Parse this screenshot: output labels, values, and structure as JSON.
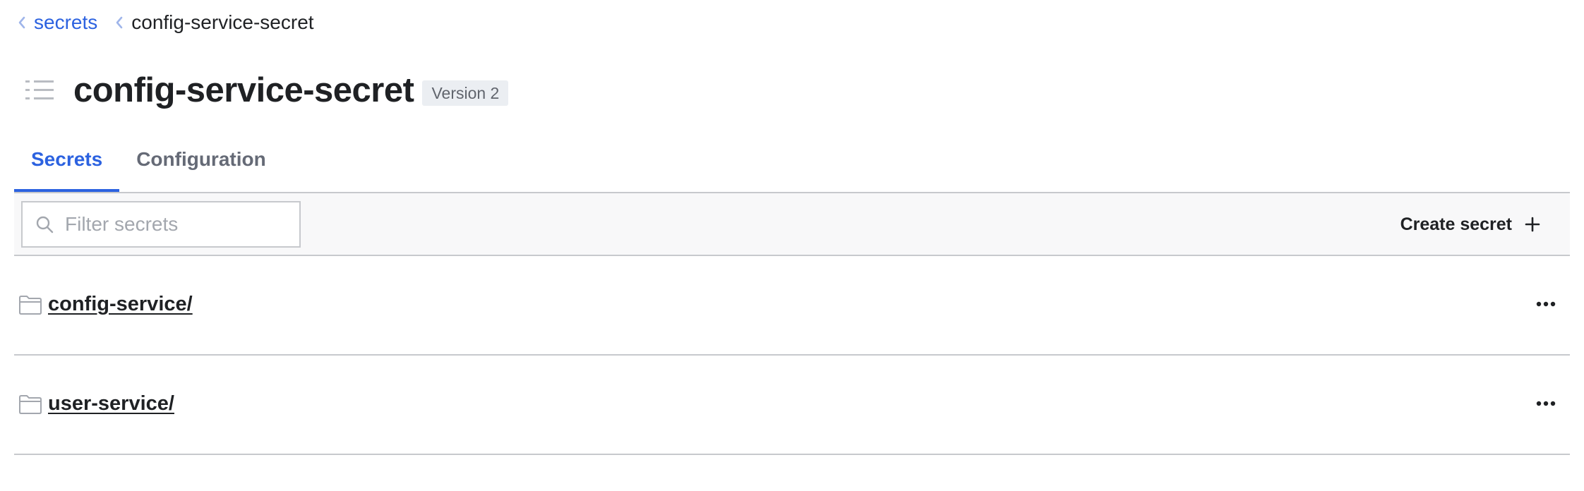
{
  "breadcrumb": {
    "items": [
      {
        "label": "secrets"
      },
      {
        "label": "config-service-secret"
      }
    ]
  },
  "header": {
    "title": "config-service-secret",
    "version_badge": "Version 2"
  },
  "tabs": [
    {
      "label": "Secrets",
      "active": true
    },
    {
      "label": "Configuration",
      "active": false
    }
  ],
  "toolbar": {
    "filter_placeholder": "Filter secrets",
    "filter_value": "",
    "create_label": "Create secret"
  },
  "list": {
    "items": [
      {
        "label": "config-service/",
        "icon": "folder-icon"
      },
      {
        "label": "user-service/",
        "icon": "folder-icon"
      }
    ]
  },
  "colors": {
    "accent": "#2c62e0",
    "text": "#1f2124",
    "muted": "#656a76",
    "border": "#c7c9cd",
    "toolbar_bg": "#f8f8f9",
    "badge_bg": "#ebeef2"
  }
}
